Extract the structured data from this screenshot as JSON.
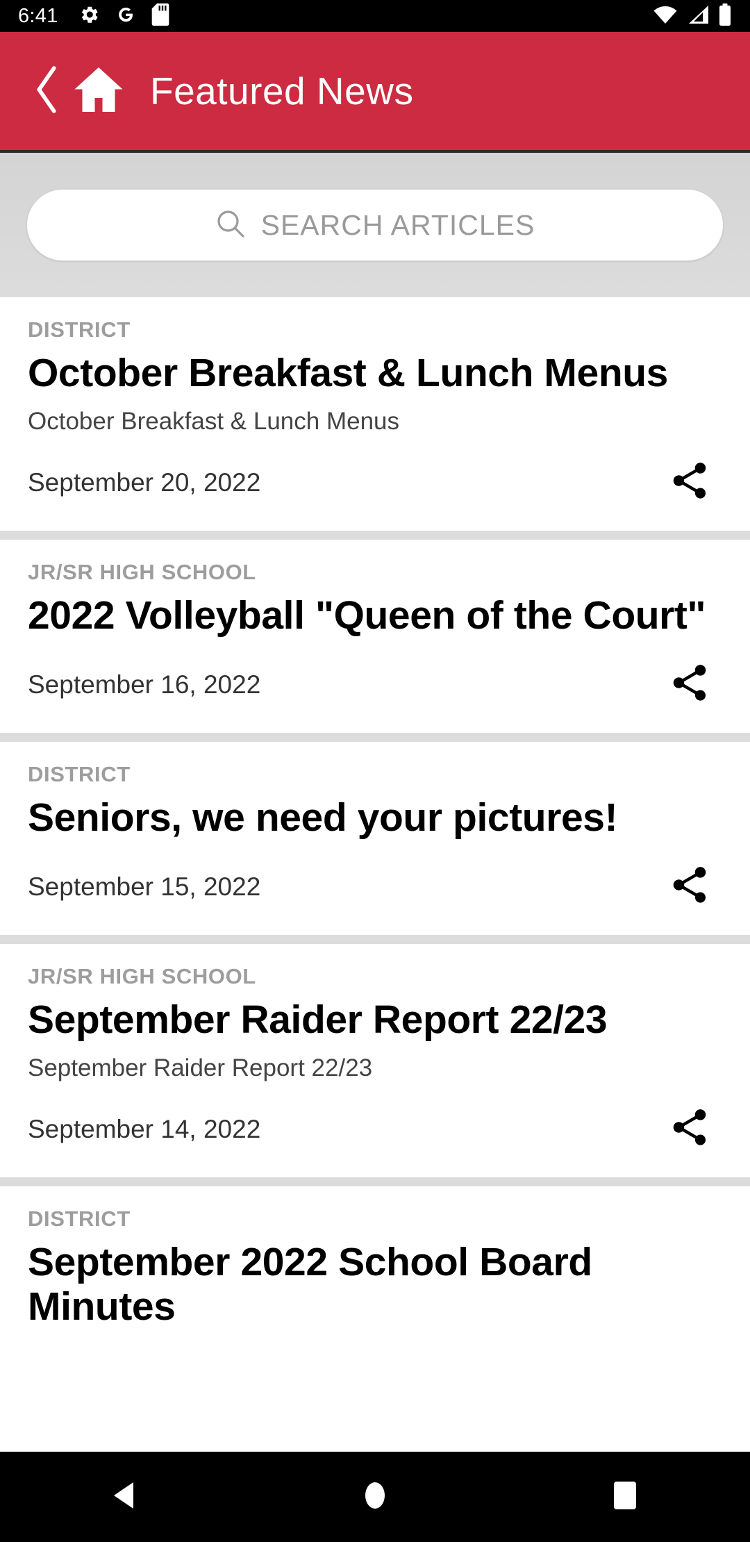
{
  "status_bar": {
    "time": "6:41",
    "left_icons": [
      "settings-gear-icon",
      "google-g-icon",
      "sd-card-icon"
    ],
    "right_icons": [
      "wifi-icon",
      "cellular-signal-icon",
      "battery-icon"
    ]
  },
  "header": {
    "title": "Featured News",
    "back_icon": "chevron-left-icon",
    "home_icon": "home-icon",
    "background_color": "#CC2B42",
    "text_color": "#FFFFFF"
  },
  "search": {
    "placeholder": "SEARCH ARTICLES",
    "value": "",
    "icon": "search-icon"
  },
  "news": {
    "share_icon": "share-icon",
    "items": [
      {
        "category": "DISTRICT",
        "title": "October Breakfast & Lunch Menus",
        "subtitle": "October Breakfast & Lunch Menus",
        "date": "September 20, 2022"
      },
      {
        "category": "JR/SR HIGH SCHOOL",
        "title": "2022 Volleyball \"Queen of the Court\"",
        "subtitle": "",
        "date": "September 16, 2022"
      },
      {
        "category": "DISTRICT",
        "title": "Seniors, we need your pictures!",
        "subtitle": "",
        "date": "September 15, 2022"
      },
      {
        "category": "JR/SR HIGH SCHOOL",
        "title": "September Raider Report 22/23",
        "subtitle": "September Raider Report 22/23",
        "date": "September 14, 2022"
      },
      {
        "category": "DISTRICT",
        "title": "September 2022 School Board Minutes",
        "subtitle": "",
        "date": ""
      }
    ]
  },
  "nav_bar": {
    "back_label": "back-triangle-icon",
    "home_label": "home-circle-icon",
    "recents_label": "recents-square-icon"
  }
}
